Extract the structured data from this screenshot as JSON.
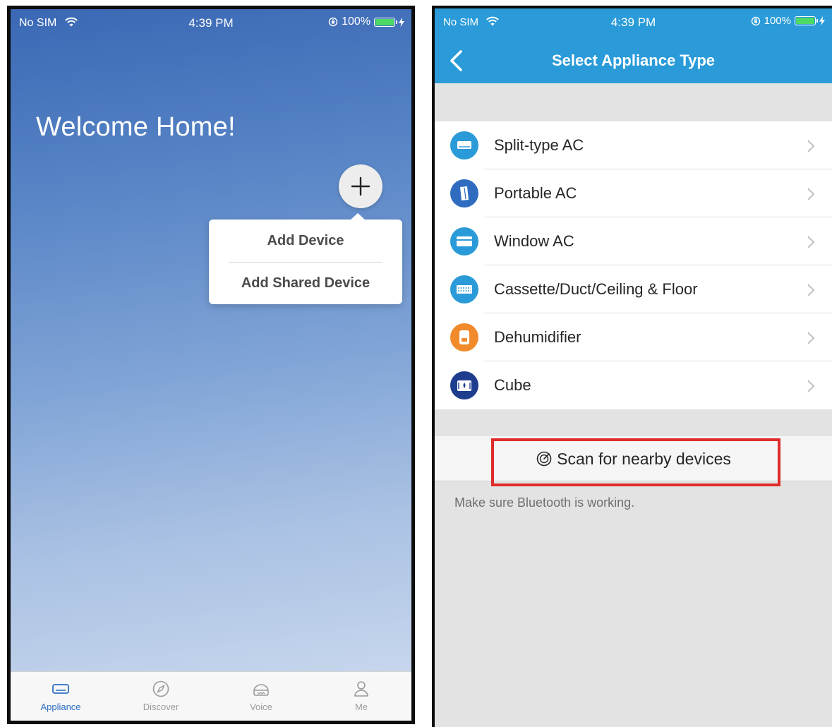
{
  "left_screen": {
    "status": {
      "carrier": "No SIM",
      "time": "4:39 PM",
      "battery": "100%",
      "battery_level": 1.0
    },
    "welcome_title": "Welcome Home!",
    "add_menu": {
      "add_device": "Add Device",
      "add_shared_device": "Add Shared Device"
    },
    "tabs": [
      {
        "label": "Appliance",
        "icon": "appliance-icon",
        "active": true
      },
      {
        "label": "Discover",
        "icon": "compass-icon",
        "active": false
      },
      {
        "label": "Voice",
        "icon": "speaker-icon",
        "active": false
      },
      {
        "label": "Me",
        "icon": "user-icon",
        "active": false
      }
    ]
  },
  "right_screen": {
    "status": {
      "carrier": "No SIM",
      "time": "4:39 PM",
      "battery": "100%",
      "battery_level": 1.0
    },
    "title": "Select Appliance Type",
    "appliances": [
      {
        "label": "Split-type AC",
        "icon": "split-ac-icon",
        "color": "#2a9bd8"
      },
      {
        "label": "Portable AC",
        "icon": "portable-ac-icon",
        "color": "#2f6cc0"
      },
      {
        "label": "Window AC",
        "icon": "window-ac-icon",
        "color": "#2a9bd8"
      },
      {
        "label": "Cassette/Duct/Ceiling & Floor",
        "icon": "cassette-ac-icon",
        "color": "#2a9bd8"
      },
      {
        "label": "Dehumidifier",
        "icon": "dehumidifier-icon",
        "color": "#f08a2a"
      },
      {
        "label": "Cube",
        "icon": "cube-icon",
        "color": "#1f3d8f"
      }
    ],
    "scan_label": "Scan for nearby devices",
    "scan_hint": "Make sure Bluetooth is working."
  },
  "colors": {
    "nav_blue": "#2a9bd8",
    "tab_active": "#2d6fc4",
    "highlight_red": "#e02b2b"
  }
}
